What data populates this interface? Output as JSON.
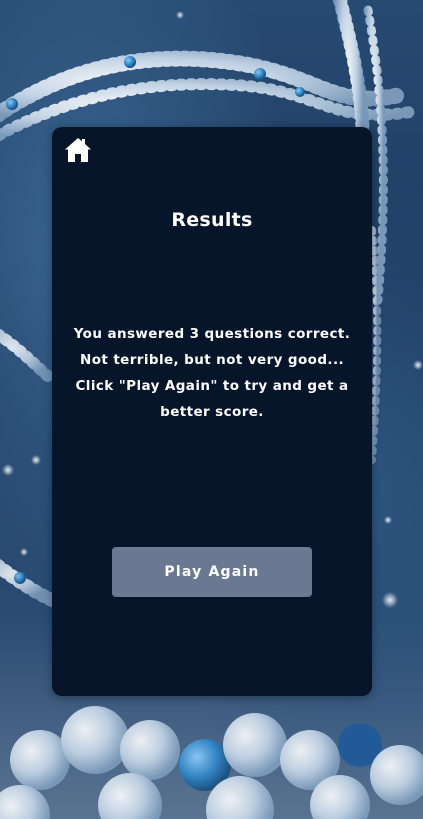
{
  "header": {
    "home_icon": "home-icon"
  },
  "results": {
    "title": "Results",
    "message": "You answered 3 questions correct. Not terrible, but not very good... Click \"Play Again\" to try and get a better score.",
    "play_again_label": "Play Again"
  },
  "colors": {
    "card_background": "#07152b",
    "button_background": "#6b7891",
    "text": "#ffffff"
  }
}
